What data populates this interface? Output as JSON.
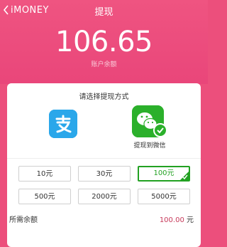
{
  "header": {
    "back_label": "iMONEY",
    "title": "提现",
    "balance": "106.65",
    "balance_label": "账户余额"
  },
  "card": {
    "title": "请选择提现方式",
    "methods": [
      {
        "name": "alipay",
        "label": ""
      },
      {
        "name": "wechat",
        "label": "提现到微信",
        "selected": true
      }
    ],
    "amounts": [
      "10元",
      "30元",
      "100元",
      "500元",
      "2000元",
      "5000元"
    ],
    "selected_amount": "100元"
  },
  "total": {
    "label": "所需余额",
    "value": "100.00",
    "unit": "元"
  },
  "colors": {
    "header_bg": "#ec4f7c",
    "accent_green": "#22a122",
    "alipay_blue": "#2aa7ea",
    "price_red": "#c7395a"
  },
  "icons": [
    "chevron-left-icon",
    "alipay-icon",
    "wechat-icon",
    "check-icon"
  ]
}
